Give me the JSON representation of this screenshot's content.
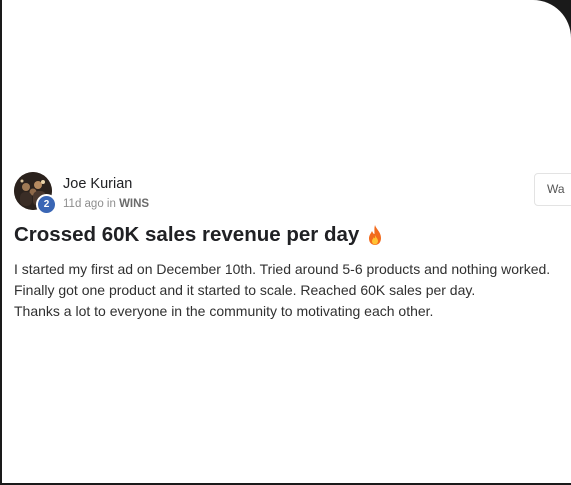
{
  "post": {
    "author": "Joe Kurian",
    "level": "2",
    "time_ago": "11d ago in ",
    "category": "WINS",
    "title": "Crossed 60K sales revenue per day",
    "body_lines": [
      "I started my first ad on December 10th. Tried around 5-6 products and nothing worked.",
      "Finally got one product and it started to scale. Reached 60K sales per day.",
      "Thanks a lot to everyone in the community to motivating each other."
    ]
  },
  "side_button": {
    "label": "Wa"
  },
  "icons": {
    "title_emoji": "fire-icon",
    "level_badge": "level-badge"
  },
  "colors": {
    "level_badge": "#3a66b5",
    "text": "#202124"
  }
}
